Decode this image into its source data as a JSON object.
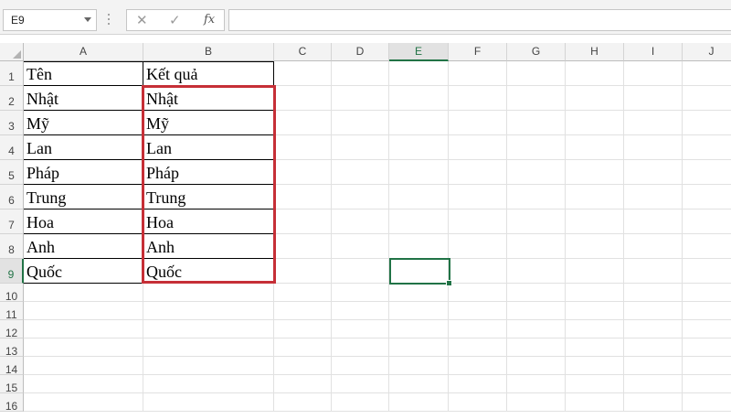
{
  "formula_bar": {
    "name_box": "E9",
    "cancel_glyph": "✕",
    "enter_glyph": "✓",
    "fx_label": "fx",
    "formula": ""
  },
  "columns": [
    "A",
    "B",
    "C",
    "D",
    "E",
    "F",
    "G",
    "H",
    "I",
    "J"
  ],
  "selected_column": "E",
  "rows": [
    "1",
    "2",
    "3",
    "4",
    "5",
    "6",
    "7",
    "8",
    "9",
    "10",
    "11",
    "12",
    "13",
    "14",
    "15",
    "16"
  ],
  "selected_row": "9",
  "table": {
    "header": {
      "A": "Tên",
      "B": "Kết quả"
    },
    "data": [
      {
        "A": "Nhật",
        "B": "Nhật"
      },
      {
        "A": "Mỹ",
        "B": "Mỹ"
      },
      {
        "A": "Lan",
        "B": "Lan"
      },
      {
        "A": "Pháp",
        "B": "Pháp"
      },
      {
        "A": "Trung",
        "B": "Trung"
      },
      {
        "A": "Hoa",
        "B": "Hoa"
      },
      {
        "A": "Anh",
        "B": "Anh"
      },
      {
        "A": "Quốc",
        "B": "Quốc"
      }
    ]
  },
  "active_cell": "E9",
  "colors": {
    "accent": "#217346",
    "highlight_box": "#c62f37"
  }
}
